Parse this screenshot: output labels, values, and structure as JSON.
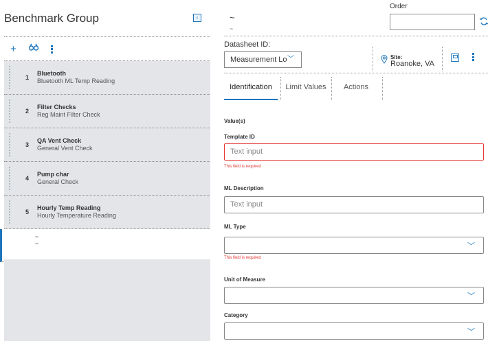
{
  "left_panel": {
    "title": "Benchmark Group",
    "collapse_glyph": "‹",
    "toolbar": {
      "add_icon": "plus-icon",
      "search_icon": "binoculars-icon",
      "menu_icon": "kebab-menu-icon"
    },
    "items": [
      {
        "num": "1",
        "title": "Bluetooth",
        "subtitle": "Bluetooth ML Temp Reading"
      },
      {
        "num": "2",
        "title": "Filter Checks",
        "subtitle": "Reg Maint Filter Check"
      },
      {
        "num": "3",
        "title": "QA Vent Check",
        "subtitle": "General Vent Check"
      },
      {
        "num": "4",
        "title": "Pump char",
        "subtitle": "General Check"
      },
      {
        "num": "5",
        "title": "Hourly Temp Reading",
        "subtitle": "Hourly Temperature Reading"
      }
    ],
    "new_item": {
      "line1": "~",
      "line2": "~"
    }
  },
  "header": {
    "title": "~",
    "subtitle": "~",
    "order_label": "Order",
    "order_value": "",
    "refresh_icon": "refresh-icon"
  },
  "datasheet": {
    "label": "Datasheet ID:",
    "value": "Measurement Lo",
    "chevron": "﹀"
  },
  "site": {
    "label": "Site:",
    "value": "Roanoke, VA"
  },
  "tabs": [
    {
      "label": "Identification",
      "active": true
    },
    {
      "label": "Limit Values",
      "active": false
    },
    {
      "label": "Actions",
      "active": false
    }
  ],
  "form": {
    "section_title": "Value(s)",
    "template_id": {
      "label": "Template ID",
      "placeholder": "Text input",
      "error": "This field is required"
    },
    "ml_description": {
      "label": "ML Description",
      "placeholder": "Text input"
    },
    "ml_type": {
      "label": "ML Type",
      "value": "",
      "error": "This field is required"
    },
    "unit_of_measure": {
      "label": "Unit of Measure",
      "value": ""
    },
    "category": {
      "label": "Category",
      "value": ""
    },
    "chevron": "﹀"
  },
  "colors": {
    "accent": "#1c75bc",
    "error": "#e53935",
    "list_bg": "#e3e5e9"
  }
}
